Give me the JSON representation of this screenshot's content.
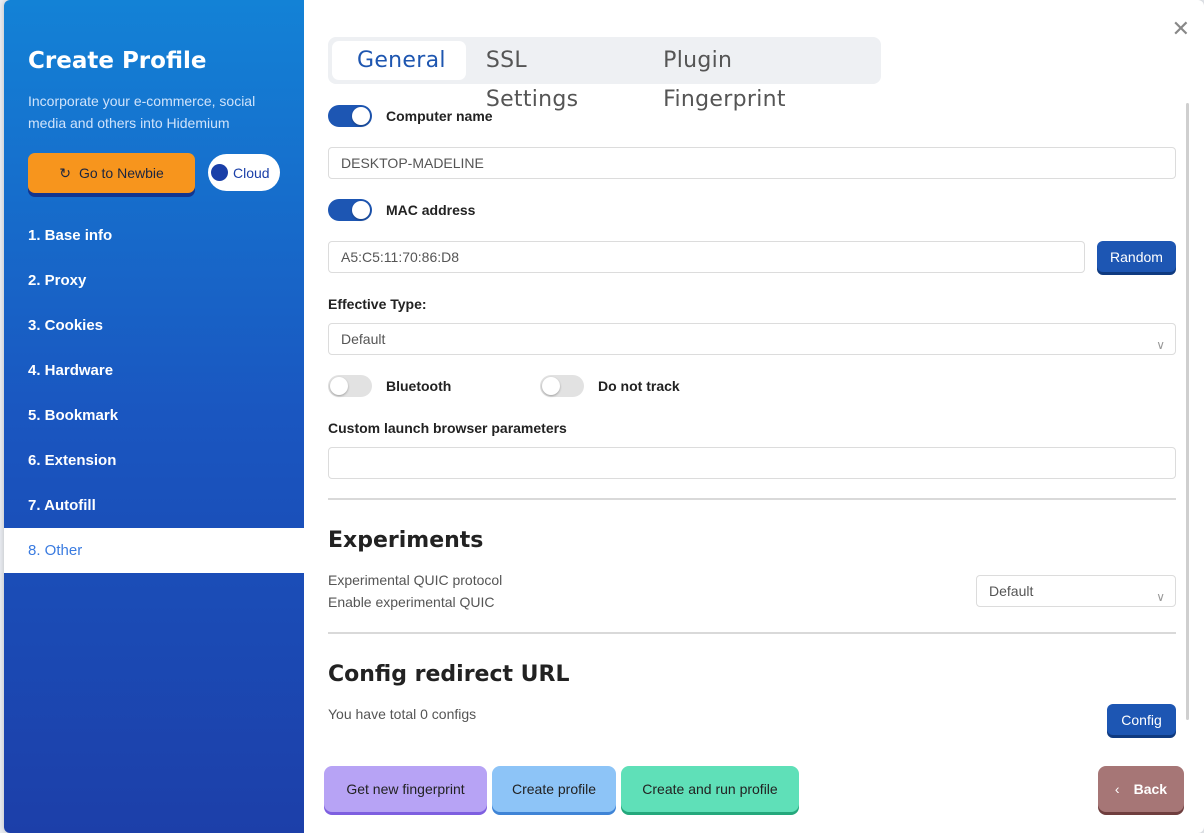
{
  "sidebar": {
    "title": "Create Profile",
    "subtitle": "Incorporate your e-commerce, social media and others into Hidemium",
    "newbie_label": "Go to Newbie",
    "cloud_label": "Cloud",
    "items": [
      {
        "label": "1. Base info"
      },
      {
        "label": "2. Proxy"
      },
      {
        "label": "3. Cookies"
      },
      {
        "label": "4. Hardware"
      },
      {
        "label": "5. Bookmark"
      },
      {
        "label": "6. Extension"
      },
      {
        "label": "7. Autofill"
      },
      {
        "label": "8. Other"
      }
    ],
    "active_index": 7
  },
  "tabs": [
    {
      "label": "General"
    },
    {
      "label": "SSL Settings"
    },
    {
      "label": "Plugin Fingerprint"
    }
  ],
  "general": {
    "computer_name": {
      "label": "Computer name",
      "enabled": true,
      "value": "DESKTOP-MADELINE"
    },
    "mac_address": {
      "label": "MAC address",
      "enabled": true,
      "value": "A5:C5:11:70:86:D8",
      "random_label": "Random"
    },
    "effective_type": {
      "label": "Effective Type:",
      "value": "Default"
    },
    "bluetooth": {
      "label": "Bluetooth",
      "enabled": false
    },
    "do_not_track": {
      "label": "Do not track",
      "enabled": false
    },
    "custom_params": {
      "label": "Custom launch browser parameters",
      "value": ""
    }
  },
  "experiments": {
    "title": "Experiments",
    "quic_line1": "Experimental QUIC protocol",
    "quic_line2": "Enable experimental QUIC",
    "quic_value": "Default"
  },
  "redirect": {
    "title": "Config redirect URL",
    "total_text": "You have total 0 configs",
    "config_label": "Config"
  },
  "footer": {
    "get_fingerprint": "Get new fingerprint",
    "create_profile": "Create profile",
    "create_run": "Create and run profile",
    "back": "Back"
  },
  "colors": {
    "accent": "#1d56b3",
    "orange": "#f7951d",
    "purple": "#b7a3f5",
    "sky": "#8dc4f7",
    "mint": "#5fe0b8",
    "brown": "#a67676"
  }
}
